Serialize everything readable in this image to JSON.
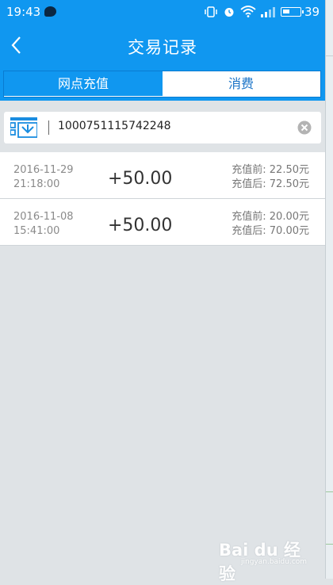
{
  "status_bar": {
    "time": "19:43",
    "battery": "39"
  },
  "header": {
    "title": "交易记录"
  },
  "tabs": [
    {
      "label": "网点充值",
      "active": true
    },
    {
      "label": "消费",
      "active": false
    }
  ],
  "search": {
    "value": "1000751115742248"
  },
  "records": [
    {
      "date": "2016-11-29",
      "time": "21:18:00",
      "amount": "+50.00",
      "before": "充值前: 22.50元",
      "after": "充值后: 72.50元"
    },
    {
      "date": "2016-11-08",
      "time": "15:41:00",
      "amount": "+50.00",
      "before": "充值前: 20.00元",
      "after": "充值后: 70.00元"
    }
  ],
  "watermark": {
    "text": "Bai du 经验",
    "sub": "jingyan.baidu.com"
  },
  "colors": {
    "primary": "#1097f0",
    "background": "#dfe3e6"
  }
}
